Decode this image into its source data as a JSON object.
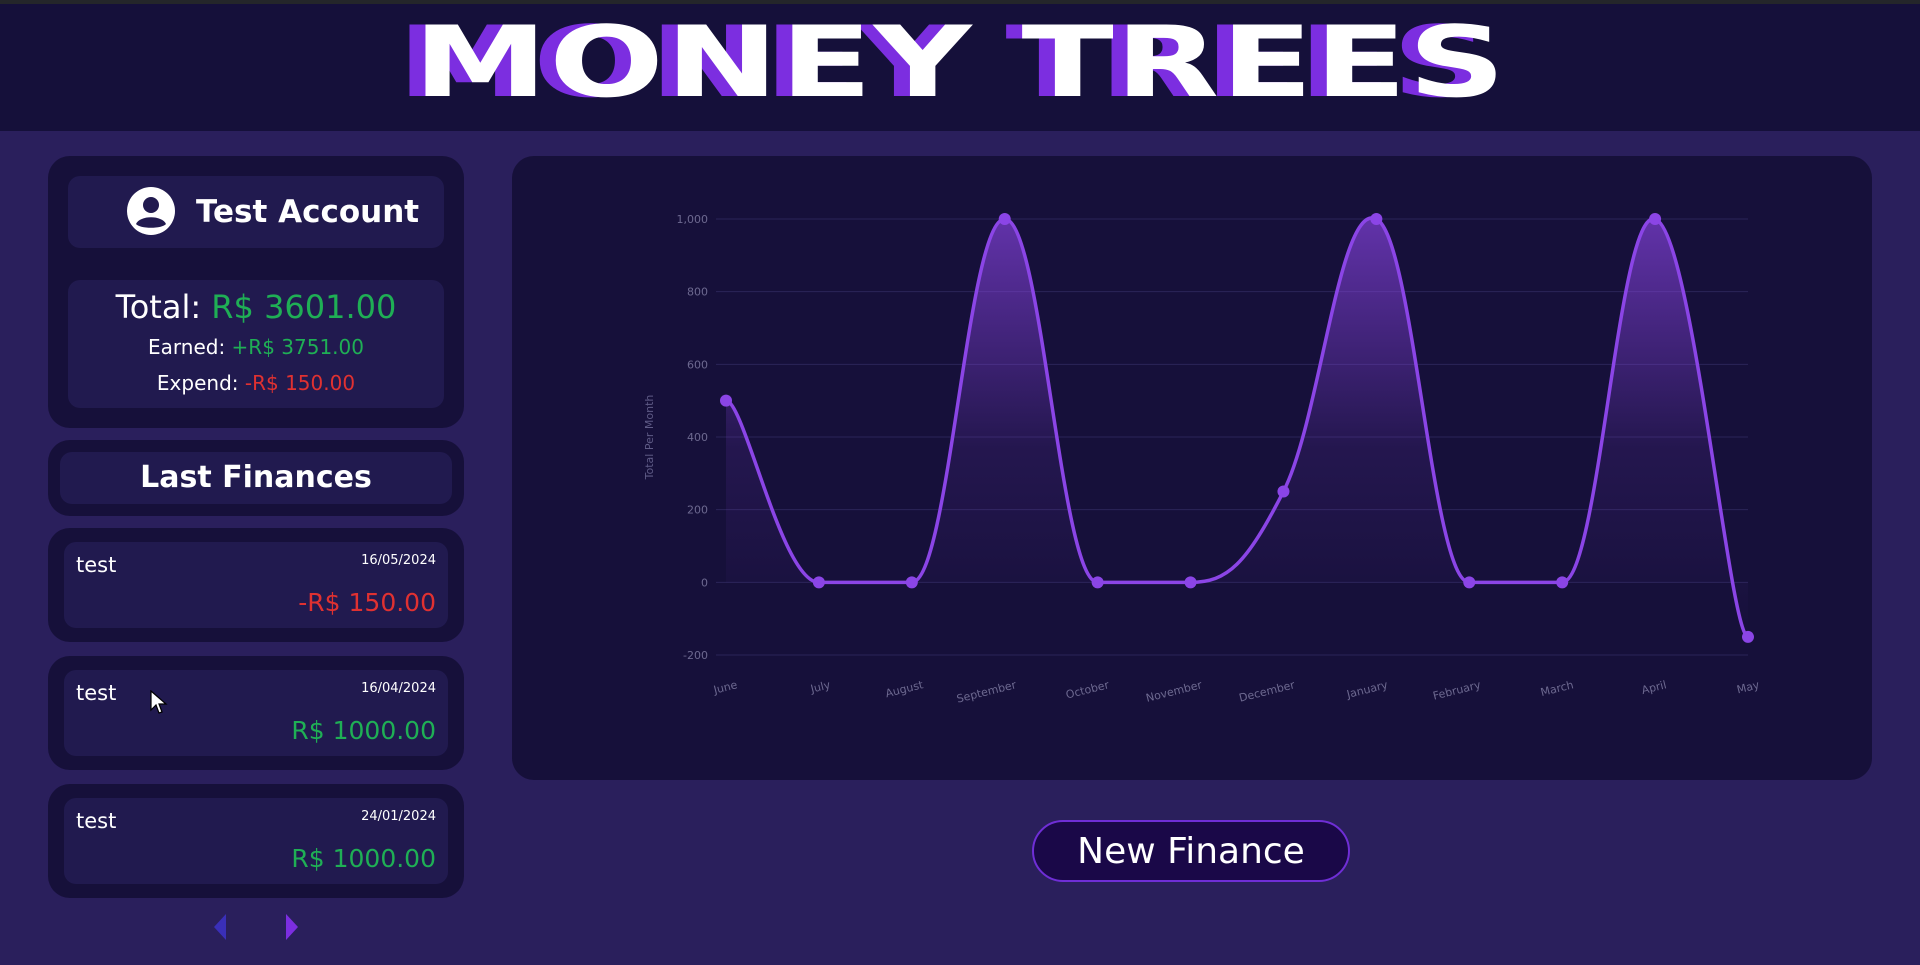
{
  "app": {
    "title": "MONEY TREES"
  },
  "account": {
    "name": "Test Account",
    "avatar_icon": "user-circle-icon",
    "total_label": "Total:",
    "total_value": "R$ 3601.00",
    "earned_label": "Earned:",
    "earned_value": "+R$ 3751.00",
    "expend_label": "Expend:",
    "expend_value": "-R$ 150.00"
  },
  "last_finances": {
    "title": "Last Finances",
    "items": [
      {
        "name": "test",
        "date": "16/05/2024",
        "amount": "-R$ 150.00",
        "type": "expense"
      },
      {
        "name": "test",
        "date": "16/04/2024",
        "amount": "R$ 1000.00",
        "type": "income"
      },
      {
        "name": "test",
        "date": "24/01/2024",
        "amount": "R$ 1000.00",
        "type": "income"
      }
    ],
    "prev_icon": "chevron-left-icon",
    "next_icon": "chevron-right-icon"
  },
  "actions": {
    "new_finance_label": "New Finance"
  },
  "colors": {
    "accent": "#8b45e6",
    "income": "#1faf55",
    "expense": "#e03131",
    "background": "#2a1f5c",
    "panel": "#16103a"
  },
  "chart_data": {
    "type": "line",
    "categories": [
      "June",
      "July",
      "August",
      "September",
      "October",
      "November",
      "December",
      "January",
      "February",
      "March",
      "April",
      "May"
    ],
    "values": [
      500,
      0,
      0,
      1000,
      0,
      0,
      250,
      1000,
      0,
      0,
      1000,
      -150
    ],
    "ylabel": "Total Per Month",
    "xlabel": "",
    "ylim": [
      -200,
      1000
    ],
    "yticks": [
      "-200",
      "0",
      "200",
      "400",
      "600",
      "800",
      "1,000"
    ],
    "grid": true,
    "fill": true,
    "smooth": true
  }
}
